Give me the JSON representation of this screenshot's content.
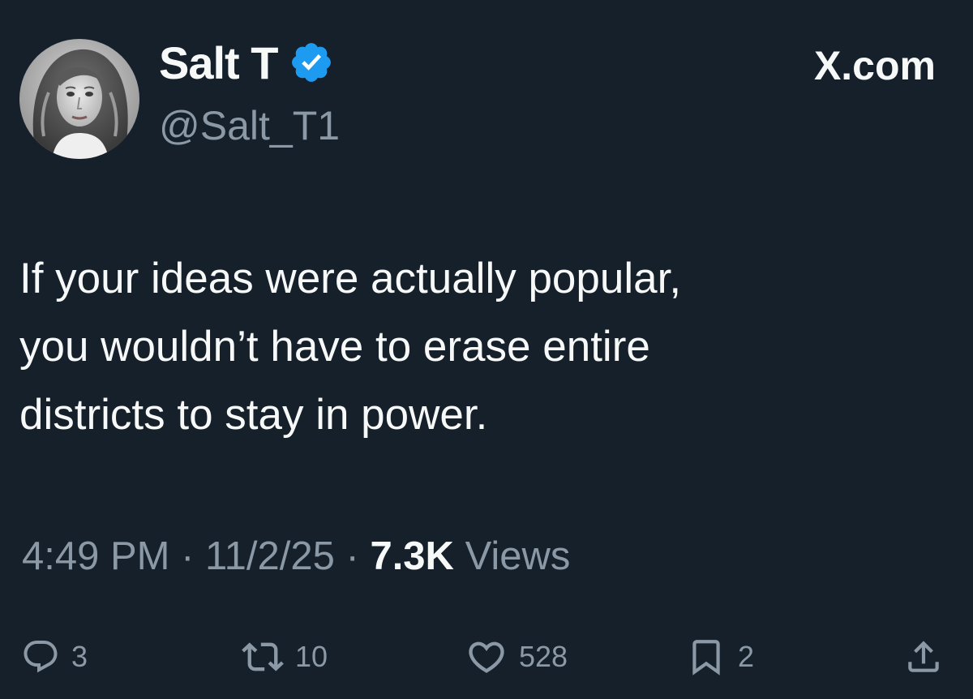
{
  "author": {
    "display_name": "Salt T",
    "handle": "@Salt_T1",
    "verified": true,
    "avatar_icon": "profile-photo-woman"
  },
  "site_label": "X.com",
  "tweet": {
    "text": "If your ideas were actually popular,\nyou wouldn’t have to erase entire\ndistricts to stay in power."
  },
  "meta": {
    "time": "4:49 PM",
    "separator": " · ",
    "date": "11/2/25",
    "views_count": "7.3K",
    "views_label": " Views"
  },
  "actions": {
    "replies": "3",
    "reposts": "10",
    "likes": "528",
    "bookmarks": "2"
  },
  "colors": {
    "background": "#15202b",
    "text_primary": "#f7f9f9",
    "text_secondary": "#8b98a5",
    "verified_badge": "#1d9bf0"
  }
}
